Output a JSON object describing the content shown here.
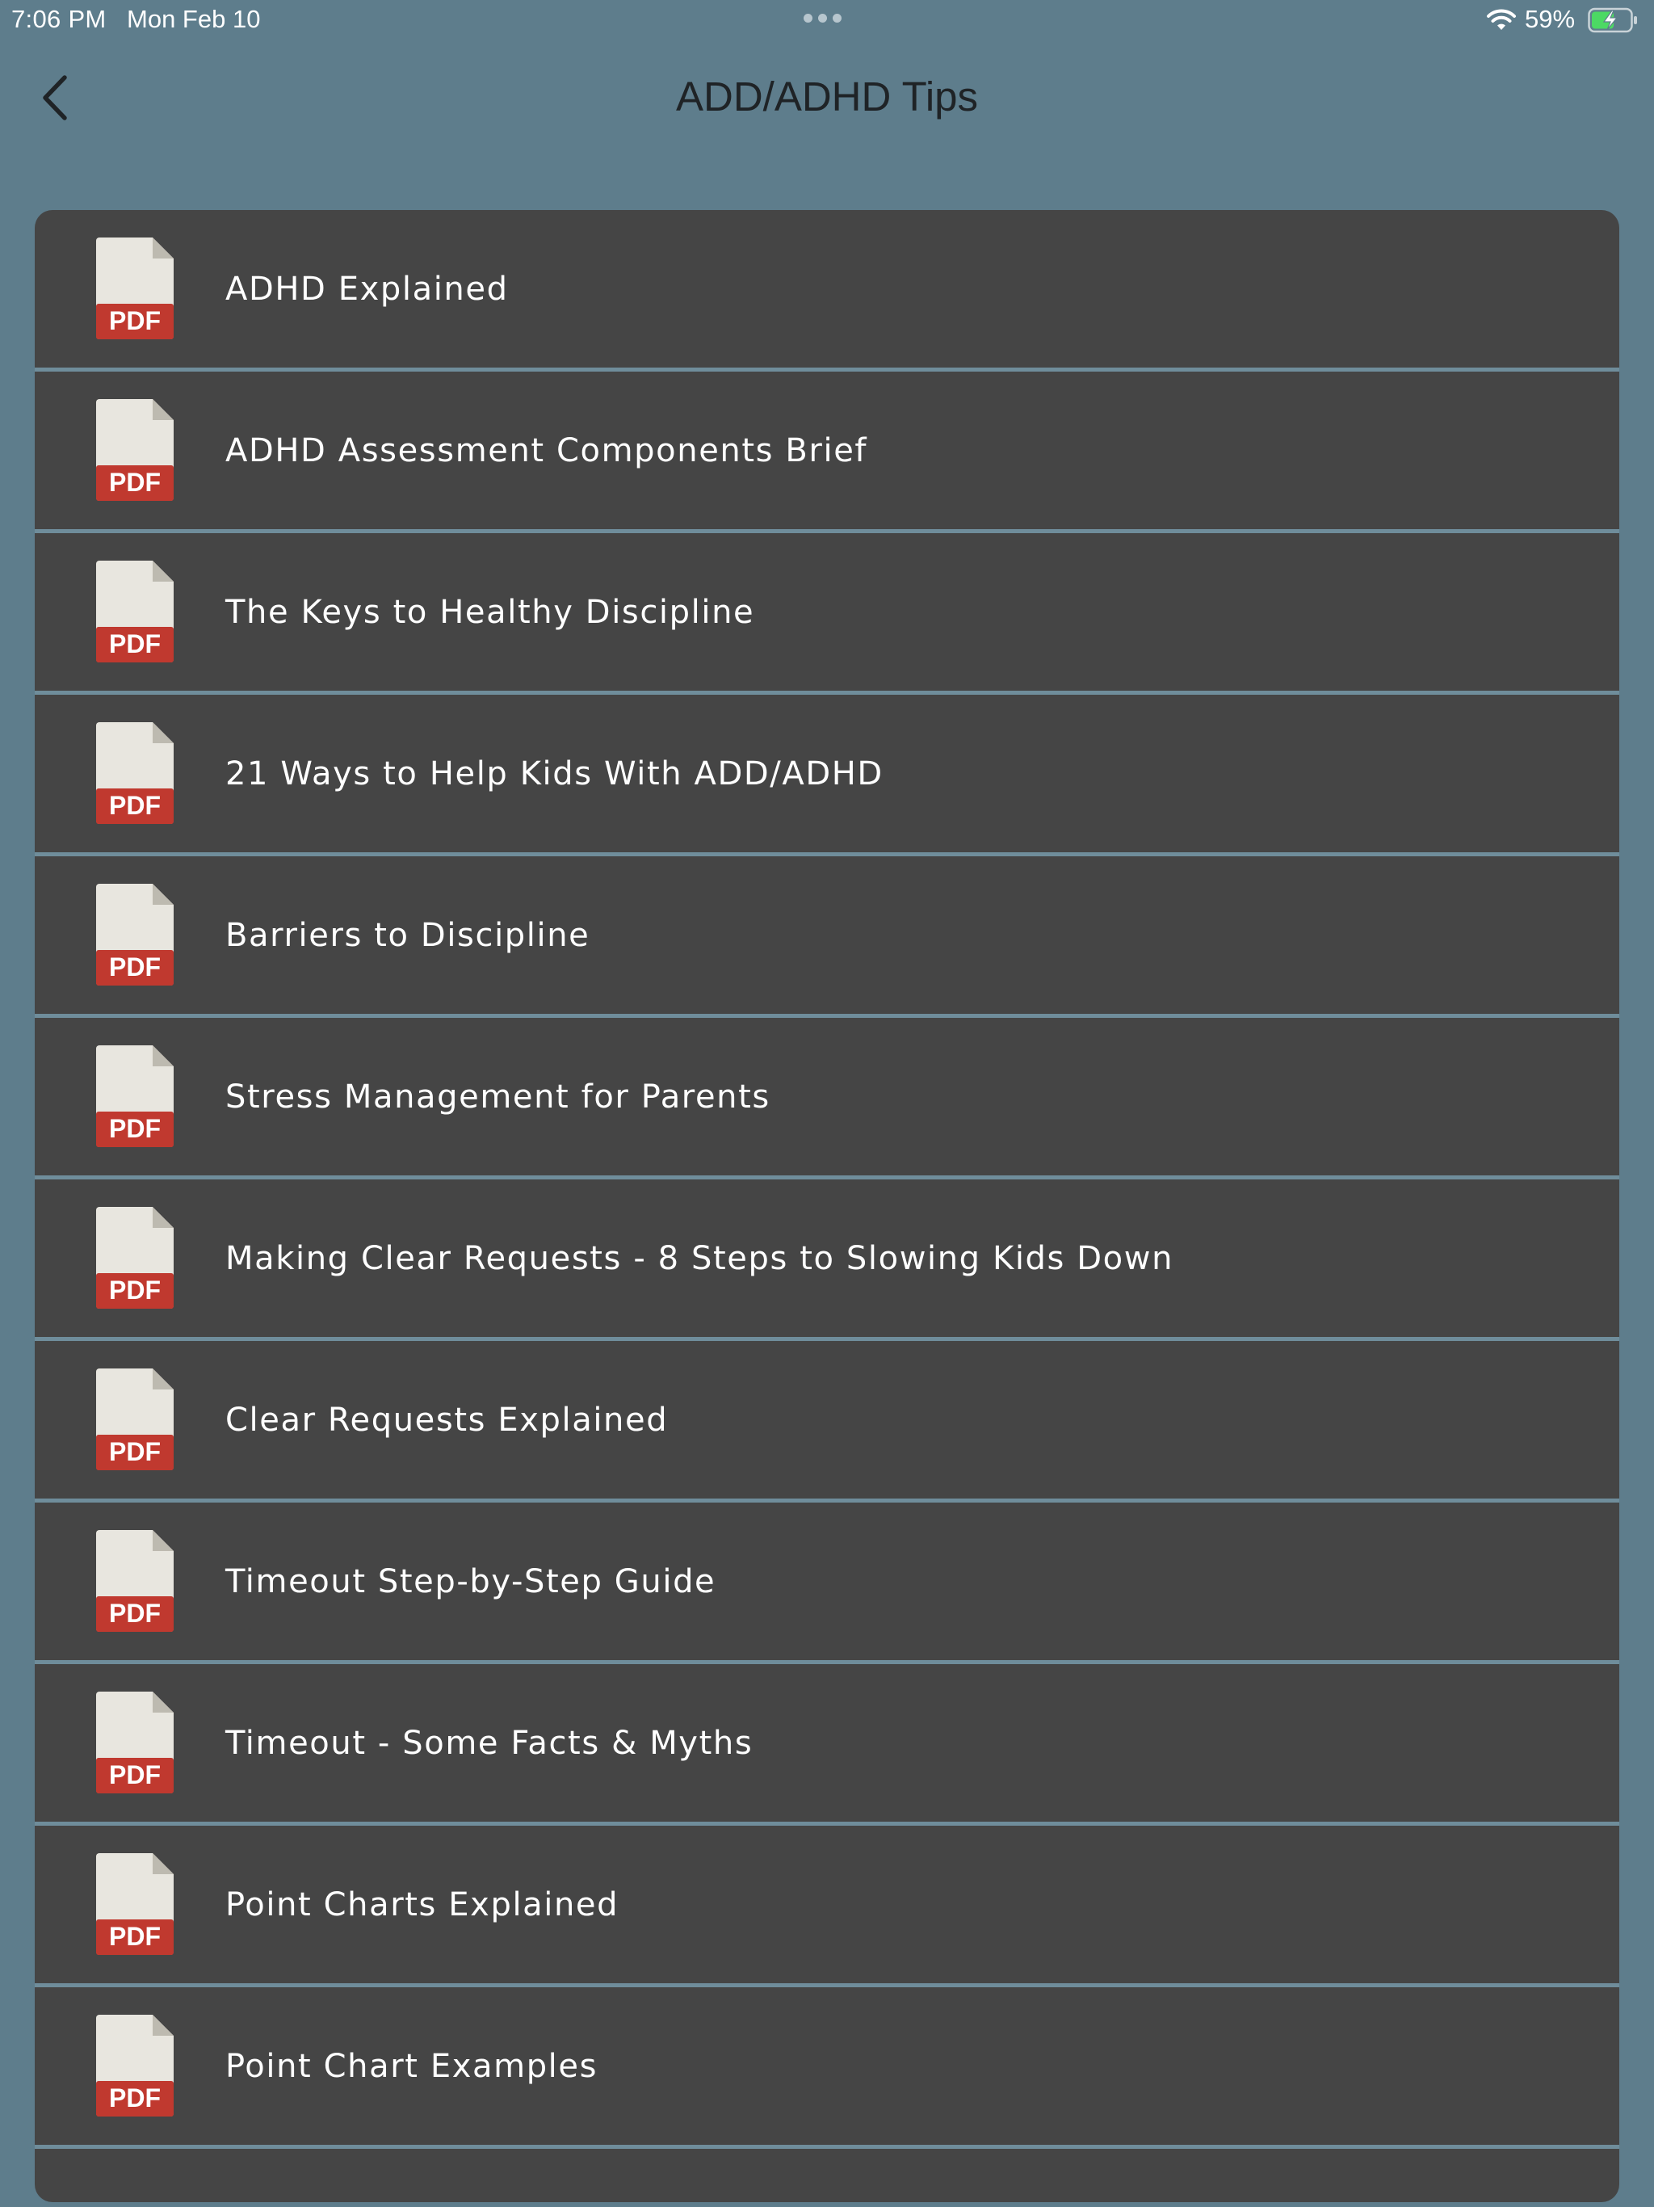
{
  "status_bar": {
    "time": "7:06 PM",
    "date": "Mon Feb 10",
    "battery_percent": "59%",
    "battery_level": 0.59,
    "charging": true,
    "icons": [
      "multitasking-dots-icon",
      "wifi-icon",
      "battery-charging-icon"
    ]
  },
  "nav": {
    "title": "ADD/ADHD Tips",
    "back_icon": "chevron-left-icon"
  },
  "list": {
    "file_badge": "PDF",
    "colors": {
      "page_background": "#5e7d8c",
      "card_background": "#454545",
      "separator": "#6f8d9b",
      "pdf_badge": "#c0392f",
      "pdf_page": "#e8e6df"
    },
    "items": [
      {
        "label": "ADHD Explained"
      },
      {
        "label": "ADHD Assessment Components Brief"
      },
      {
        "label": "The Keys to Healthy Discipline"
      },
      {
        "label": "21 Ways to Help Kids With ADD/ADHD"
      },
      {
        "label": "Barriers to Discipline"
      },
      {
        "label": "Stress Management for Parents"
      },
      {
        "label": "Making Clear Requests - 8 Steps to Slowing Kids Down"
      },
      {
        "label": "Clear Requests Explained"
      },
      {
        "label": "Timeout Step-by-Step Guide"
      },
      {
        "label": "Timeout - Some Facts & Myths"
      },
      {
        "label": "Point Charts Explained"
      },
      {
        "label": "Point Chart Examples"
      }
    ]
  }
}
